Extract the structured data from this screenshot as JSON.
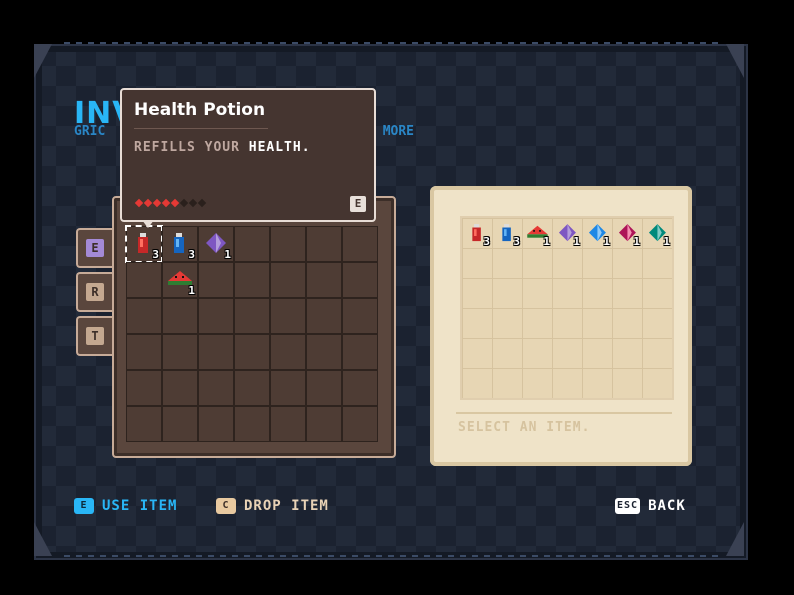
{
  "header": {
    "title": "INV",
    "subtitle_left": "GRIC",
    "subtitle_right": "MORE"
  },
  "tooltip": {
    "name": "Health Potion",
    "desc_prefix": "REFILLS YOUR ",
    "desc_highlight": "HEALTH.",
    "rarity_filled": 5,
    "rarity_total": 8,
    "key": "E"
  },
  "tabs": [
    {
      "key": "E",
      "active": true
    },
    {
      "key": "R",
      "active": false
    },
    {
      "key": "T",
      "active": false
    }
  ],
  "inventory": {
    "slots": [
      {
        "index": 0,
        "icon": "red-potion-icon",
        "qty": "3",
        "selected": true
      },
      {
        "index": 1,
        "icon": "blue-potion-icon",
        "qty": "3"
      },
      {
        "index": 2,
        "icon": "purple-gem-icon",
        "qty": "1"
      },
      {
        "index": 8,
        "icon": "watermelon-slice-icon",
        "qty": "1"
      }
    ]
  },
  "chest": {
    "slots": [
      {
        "index": 0,
        "icon": "red-potion-icon",
        "qty": "3"
      },
      {
        "index": 1,
        "icon": "blue-potion-icon",
        "qty": "3"
      },
      {
        "index": 2,
        "icon": "watermelon-slice-icon",
        "qty": "1"
      },
      {
        "index": 3,
        "icon": "purple-gem-icon",
        "qty": "1"
      },
      {
        "index": 4,
        "icon": "blue-gem-icon",
        "qty": "1"
      },
      {
        "index": 5,
        "icon": "red-gem-icon",
        "qty": "1"
      },
      {
        "index": 6,
        "icon": "green-gem-icon",
        "qty": "1"
      }
    ],
    "status": "SELECT AN ITEM."
  },
  "footer": {
    "use": {
      "key": "E",
      "label": "USE ITEM"
    },
    "drop": {
      "key": "C",
      "label": "DROP ITEM"
    },
    "back": {
      "key": "ESC",
      "label": "BACK"
    }
  },
  "colors": {
    "accent": "#29b6f6",
    "rarity_on": "#e53935",
    "rarity_off": "#2a201c",
    "parchment": "#efe3c8"
  }
}
